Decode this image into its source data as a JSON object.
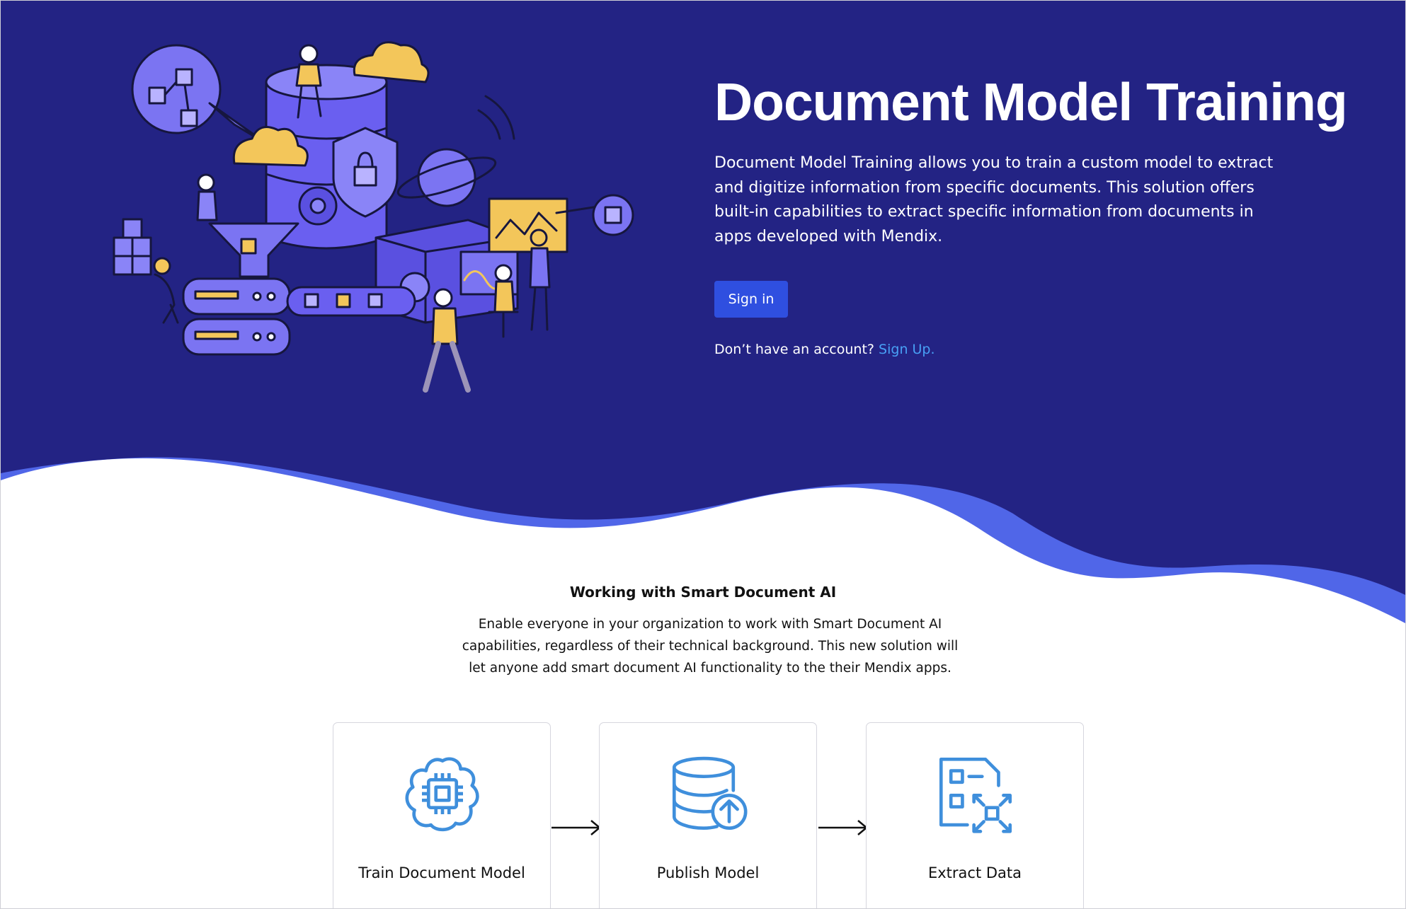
{
  "hero": {
    "title": "Document Model Training",
    "description": "Document Model Training allows you to train a custom model to extract and digitize information from specific documents. This solution offers built-in capabilities to extract specific information from documents in apps developed with Mendix.",
    "signin_label": "Sign in",
    "account_prompt": "Don’t have an account?",
    "signup_label": "Sign Up."
  },
  "section": {
    "title": "Working with Smart Document AI",
    "description": "Enable everyone in your organization to work with Smart Document AI capabilities, regardless of their technical background. This new solution will let anyone add smart document AI functionality to the their Mendix apps."
  },
  "steps": [
    {
      "label": "Train Document Model",
      "icon": "chip-cloud-icon"
    },
    {
      "label": "Publish Model",
      "icon": "database-upload-icon"
    },
    {
      "label": "Extract Data",
      "icon": "document-scan-icon"
    }
  ],
  "colors": {
    "hero_background": "#232384",
    "wave_accent": "#5066e8",
    "button": "#2f4fe0",
    "link": "#48a0f5",
    "icon": "#3f8fdc"
  }
}
